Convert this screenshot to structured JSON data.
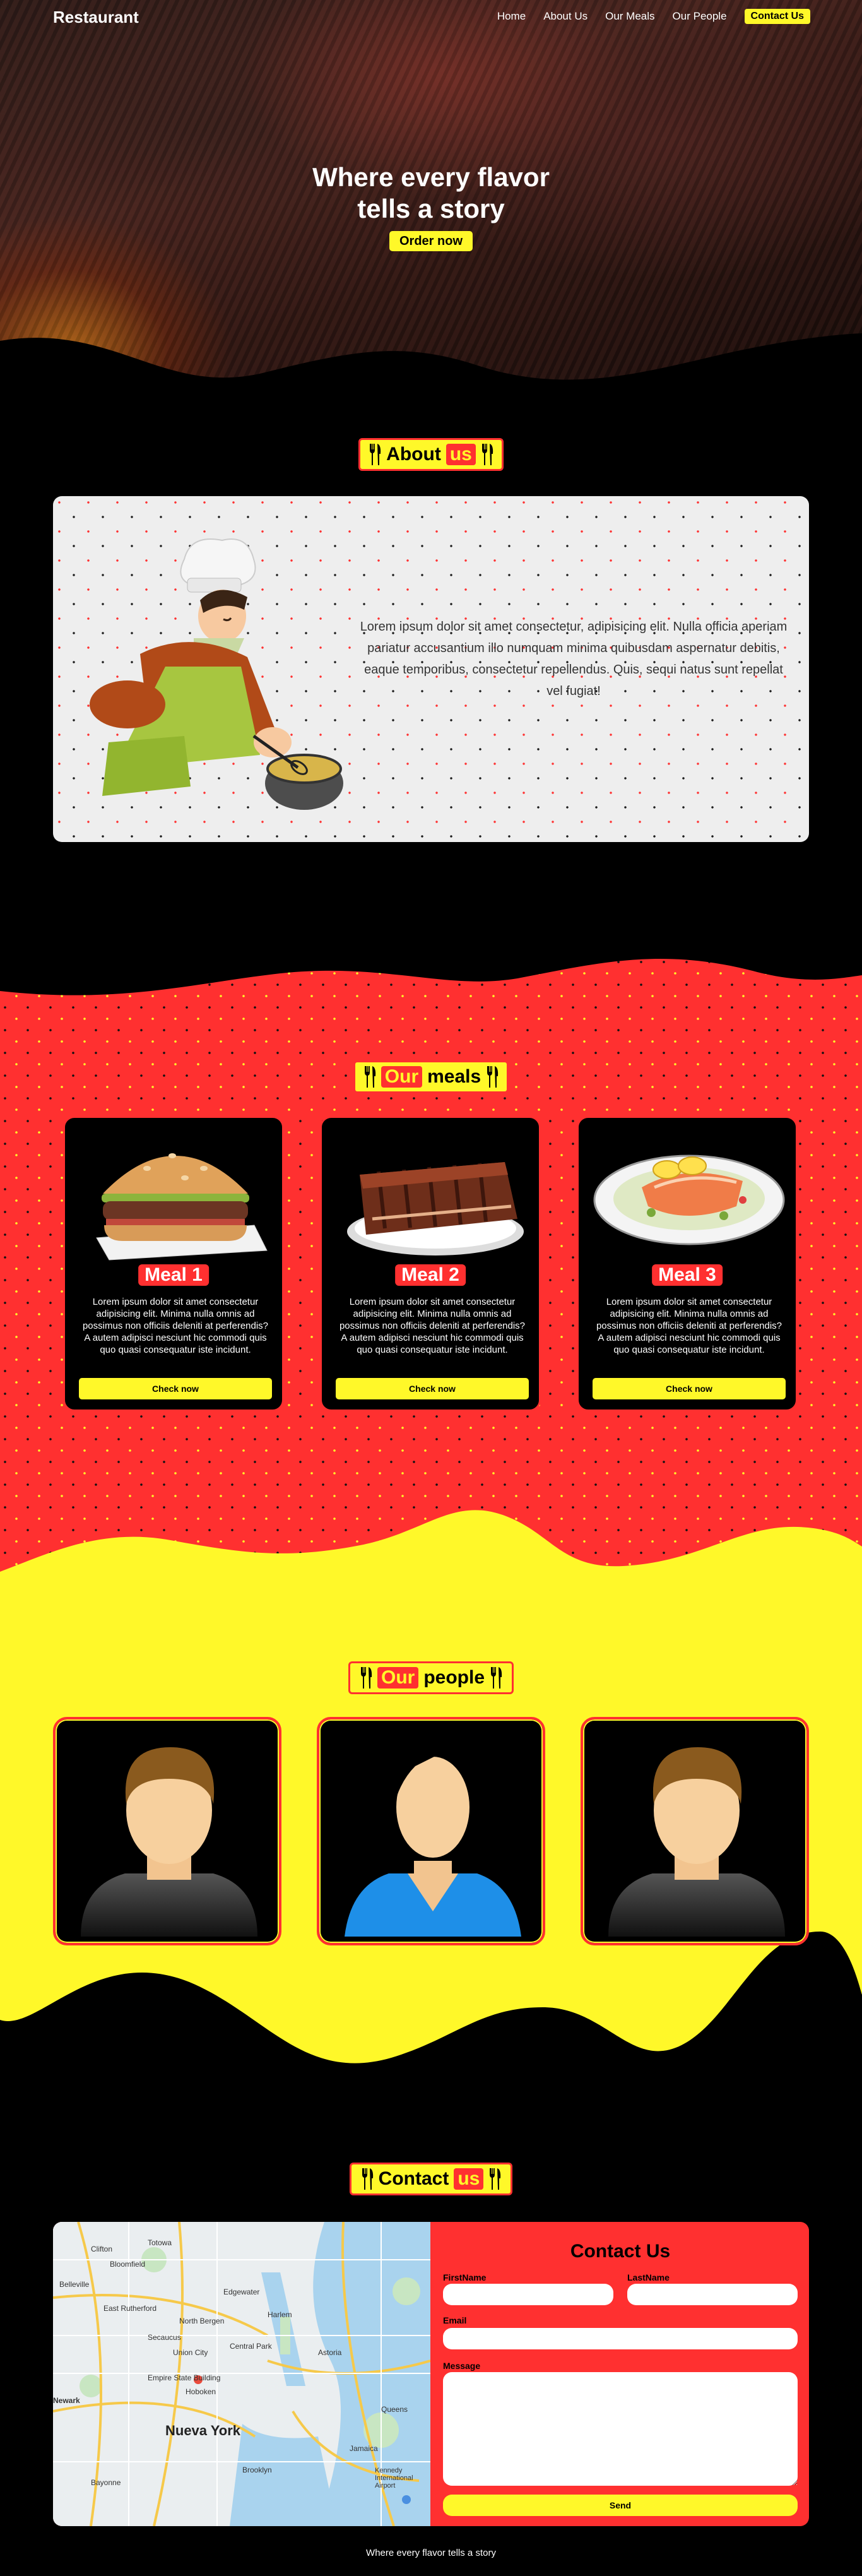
{
  "nav": {
    "brand": "Restaurant",
    "links": [
      "Home",
      "About Us",
      "Our Meals",
      "Our People"
    ],
    "cta": "Contact Us"
  },
  "hero": {
    "title_line1": "Where every flavor",
    "title_line2": "tells a story",
    "button": "Order now"
  },
  "about": {
    "title_pre": "About",
    "title_hl": "us",
    "text": "Lorem ipsum dolor sit amet consectetur, adipisicing elit. Nulla officia aperiam pariatur accusantium illo numquam minima quibusdam aspernatur debitis, eaque temporibus, consectetur repellendus. Quis, sequi natus sunt repellat vel fugiat!"
  },
  "meals": {
    "title_hl": "Our",
    "title_post": "meals",
    "items": [
      {
        "name": "Meal 1",
        "desc": "Lorem ipsum dolor sit amet consectetur adipisicing elit. Minima nulla omnis ad possimus non officiis deleniti at perferendis? A autem adipisci nesciunt hic commodi quis quo quasi consequatur iste incidunt.",
        "button": "Check now",
        "icon": "burger"
      },
      {
        "name": "Meal 2",
        "desc": "Lorem ipsum dolor sit amet consectetur adipisicing elit. Minima nulla omnis ad possimus non officiis deleniti at perferendis? A autem adipisci nesciunt hic commodi quis quo quasi consequatur iste incidunt.",
        "button": "Check now",
        "icon": "ribs"
      },
      {
        "name": "Meal 3",
        "desc": "Lorem ipsum dolor sit amet consectetur adipisicing elit. Minima nulla omnis ad possimus non officiis deleniti at perferendis? A autem adipisci nesciunt hic commodi quis quo quasi consequatur iste incidunt.",
        "button": "Check now",
        "icon": "salmon-dish"
      }
    ]
  },
  "people": {
    "title_hl": "Our",
    "title_post": "people",
    "items": [
      {
        "icon": "male-avatar"
      },
      {
        "icon": "female-avatar"
      },
      {
        "icon": "male-avatar"
      }
    ]
  },
  "contact": {
    "title_pre": "Contact",
    "title_hl": "us",
    "form_title": "Contact Us",
    "first_name_label": "FirstName",
    "last_name_label": "LastName",
    "email_label": "Email",
    "message_label": "Message",
    "send": "Send",
    "map": {
      "city": "Nueva York",
      "labels": [
        "Totowa",
        "Belleville",
        "Bloomfield",
        "East Rutherford",
        "Clifton",
        "Edgewater",
        "North Bergen",
        "Secaucus",
        "Union City",
        "Hoboken",
        "Newark",
        "Brooklyn",
        "Queens",
        "Bayonne",
        "Kennedy International Airport",
        "Jamaica",
        "Central Park",
        "Empire State Building",
        "Harlem",
        "Astoria"
      ]
    }
  },
  "footer": "Where every flavor tells a story",
  "colors": {
    "accent_yellow": "#fff829",
    "accent_red": "#ff3030",
    "background": "#000000"
  }
}
